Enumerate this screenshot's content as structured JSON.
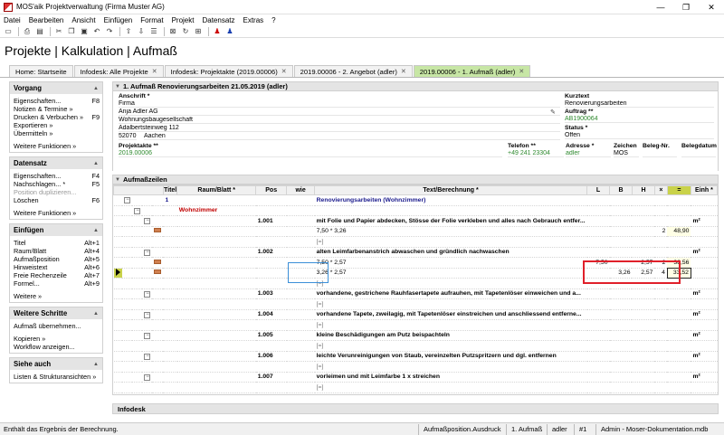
{
  "window": {
    "title": "MOS'aik Projektverwaltung (Firma Muster AG)",
    "min": "—",
    "max": "❐",
    "close": "✕"
  },
  "menu": [
    "Datei",
    "Bearbeiten",
    "Ansicht",
    "Einfügen",
    "Format",
    "Projekt",
    "Datensatz",
    "Extras",
    "?"
  ],
  "page_title": "Projekte | Kalkulation | Aufmaß",
  "tabs": [
    {
      "label": "Home: Startseite"
    },
    {
      "label": "Infodesk: Alle Projekte"
    },
    {
      "label": "Infodesk: Projektakte (2019.00006)"
    },
    {
      "label": "2019.00006 - 2. Angebot (adler)"
    },
    {
      "label": "2019.00006 - 1. Aufmaß (adler)"
    }
  ],
  "sidebar": {
    "vorgang": {
      "title": "Vorgang",
      "items": [
        {
          "label": "Eigenschaften...",
          "key": "F8"
        },
        {
          "label": "Notizen & Termine »",
          "key": ""
        },
        {
          "label": "Drucken & Verbuchen »",
          "key": "F9"
        },
        {
          "label": "Exportieren »",
          "key": ""
        },
        {
          "label": "Übermitteln »",
          "key": ""
        }
      ],
      "more": "Weitere Funktionen »"
    },
    "datensatz": {
      "title": "Datensatz",
      "items": [
        {
          "label": "Eigenschaften...",
          "key": "F4"
        },
        {
          "label": "Nachschlagen... *",
          "key": "F5"
        },
        {
          "label": "Position duplizieren...",
          "key": ""
        },
        {
          "label": "Löschen",
          "key": "F6"
        }
      ],
      "more": "Weitere Funktionen »"
    },
    "einfuegen": {
      "title": "Einfügen",
      "items": [
        {
          "label": "Titel",
          "key": "Alt+1"
        },
        {
          "label": "Raum/Blatt",
          "key": "Alt+4"
        },
        {
          "label": "Aufmaßposition",
          "key": "Alt+5"
        },
        {
          "label": "Hinweistext",
          "key": "Alt+6"
        },
        {
          "label": "Freie Rechenzeile",
          "key": "Alt+7"
        },
        {
          "label": "Formel...",
          "key": "Alt+9"
        }
      ],
      "more": "Weitere »"
    },
    "schritte": {
      "title": "Weitere Schritte",
      "items": [
        {
          "label": "Aufmaß übernehmen..."
        },
        {
          "label": "Kopieren »"
        },
        {
          "label": "Workflow anzeigen..."
        }
      ]
    },
    "siehe": {
      "title": "Siehe auch",
      "items": [
        {
          "label": "Listen & Strukturansichten »"
        }
      ]
    }
  },
  "header": {
    "section_title": "1. Aufmaß Renovierungsarbeiten 21.05.2019 (adler)",
    "anschrift_label": "Anschrift *",
    "anschrift_lines": [
      "Firma",
      "Anja Adler AG",
      "Wohnungsbaugesellschaft",
      "Adalbertsteinweg 112"
    ],
    "plz": "52070",
    "ort": "Aachen",
    "kurztext_label": "Kurztext",
    "kurztext": "Renovierungsarbeiten",
    "auftrag_label": "Auftrag **",
    "auftrag": "AB1900064",
    "status_label": "Status *",
    "status": "Offen",
    "projektakte_label": "Projektakte **",
    "projektakte": "2019.00006",
    "telefon_label": "Telefon **",
    "telefon": "+49 241 23304",
    "adresse_label": "Adresse *",
    "adresse": "adler",
    "zeichen_label": "Zeichen",
    "zeichen": "MOS",
    "belegnr_label": "Beleg-Nr.",
    "belegnr": "",
    "belegdatum_label": "Belegdatum",
    "belegdatum": ""
  },
  "grid": {
    "section_title": "Aufmaßzeilen",
    "columns": [
      "Titel",
      "Raum/Blatt *",
      "Pos",
      "wie",
      "Text/Berechnung *",
      "L",
      "B",
      "H",
      "×",
      "=",
      "Einh *"
    ],
    "rows": [
      {
        "kind": "title",
        "titel": "1",
        "raum": "",
        "pos": "",
        "text": "Renovierungsarbeiten (Wohnzimmer)",
        "l": "",
        "b": "",
        "h": "",
        "x": "",
        "eq": "",
        "einh": ""
      },
      {
        "kind": "room",
        "titel": "",
        "raum": "Wohnzimmer",
        "pos": "",
        "text": "",
        "l": "",
        "b": "",
        "h": "",
        "x": "",
        "eq": "",
        "einh": ""
      },
      {
        "kind": "pos",
        "titel": "",
        "raum": "",
        "pos": "1.001",
        "text": "mit Folie und Papier abdecken, Stösse der Folie verkleben und alles nach Gebrauch entfer...",
        "l": "",
        "b": "",
        "h": "",
        "x": "",
        "eq": "",
        "einh": "m²"
      },
      {
        "kind": "calc",
        "titel": "",
        "raum": "",
        "pos": "",
        "text": "7,50 * 3,26",
        "l": "",
        "b": "",
        "h": "",
        "x": "2",
        "eq": "48,90",
        "einh": ""
      },
      {
        "kind": "input",
        "titel": "",
        "raum": "",
        "pos": "",
        "text": "[=]",
        "l": "",
        "b": "",
        "h": "",
        "x": "",
        "eq": "",
        "einh": ""
      },
      {
        "kind": "pos",
        "titel": "",
        "raum": "",
        "pos": "1.002",
        "text": "alten Leimfarbenanstrich abwaschen und gründlich nachwaschen",
        "l": "",
        "b": "",
        "h": "",
        "x": "",
        "eq": "",
        "einh": "m²"
      },
      {
        "kind": "calc",
        "titel": "",
        "raum": "",
        "pos": "",
        "text": "7,50 * 2,57",
        "l": "7,50",
        "b": "",
        "h": "2,57",
        "x": "2",
        "eq": "38,56",
        "einh": ""
      },
      {
        "kind": "calc",
        "titel": "",
        "raum": "",
        "pos": "",
        "text": "3,26 * 2,57",
        "l": "",
        "b": "3,26",
        "h": "2,57",
        "x": "4",
        "eq": "33,52",
        "einh": ""
      },
      {
        "kind": "input",
        "titel": "",
        "raum": "",
        "pos": "",
        "text": "[=]",
        "l": "",
        "b": "",
        "h": "",
        "x": "",
        "eq": "",
        "einh": ""
      },
      {
        "kind": "pos",
        "titel": "",
        "raum": "",
        "pos": "1.003",
        "text": "vorhandene, gestrichene Rauhfasertapete aufrauhen, mit Tapetenlöser einweichen und a...",
        "l": "",
        "b": "",
        "h": "",
        "x": "",
        "eq": "",
        "einh": "m²"
      },
      {
        "kind": "input",
        "titel": "",
        "raum": "",
        "pos": "",
        "text": "[=]",
        "l": "",
        "b": "",
        "h": "",
        "x": "",
        "eq": "",
        "einh": ""
      },
      {
        "kind": "pos",
        "titel": "",
        "raum": "",
        "pos": "1.004",
        "text": "vorhandene Tapete, zweilagig, mit Tapetenlöser einstreichen und anschliessend entferne...",
        "l": "",
        "b": "",
        "h": "",
        "x": "",
        "eq": "",
        "einh": "m²"
      },
      {
        "kind": "input",
        "titel": "",
        "raum": "",
        "pos": "",
        "text": "[=]",
        "l": "",
        "b": "",
        "h": "",
        "x": "",
        "eq": "",
        "einh": ""
      },
      {
        "kind": "pos",
        "titel": "",
        "raum": "",
        "pos": "1.005",
        "text": "kleine Beschädigungen am Putz beispachteln",
        "l": "",
        "b": "",
        "h": "",
        "x": "",
        "eq": "",
        "einh": "m²"
      },
      {
        "kind": "input",
        "titel": "",
        "raum": "",
        "pos": "",
        "text": "[=]",
        "l": "",
        "b": "",
        "h": "",
        "x": "",
        "eq": "",
        "einh": ""
      },
      {
        "kind": "pos",
        "titel": "",
        "raum": "",
        "pos": "1.006",
        "text": "leichte Verunreinigungen von Staub, vereinzelten Putzspritzern und dgl. entfernen",
        "l": "",
        "b": "",
        "h": "",
        "x": "",
        "eq": "",
        "einh": "m²"
      },
      {
        "kind": "input",
        "titel": "",
        "raum": "",
        "pos": "",
        "text": "[=]",
        "l": "",
        "b": "",
        "h": "",
        "x": "",
        "eq": "",
        "einh": ""
      },
      {
        "kind": "pos",
        "titel": "",
        "raum": "",
        "pos": "1.007",
        "text": "vorleimen und mit Leimfarbe 1 x streichen",
        "l": "",
        "b": "",
        "h": "",
        "x": "",
        "eq": "",
        "einh": "m²"
      },
      {
        "kind": "input",
        "titel": "",
        "raum": "",
        "pos": "",
        "text": "[=]",
        "l": "",
        "b": "",
        "h": "",
        "x": "",
        "eq": "",
        "einh": ""
      }
    ]
  },
  "infodesk": "Infodesk",
  "status": {
    "message": "Enthält das Ergebnis der Berechnung.",
    "cells": [
      "Aufmaßposition.Ausdruck",
      "1. Aufmaß",
      "adler",
      "#1",
      "Admin - Moser-Dokumentation.mdb"
    ]
  }
}
